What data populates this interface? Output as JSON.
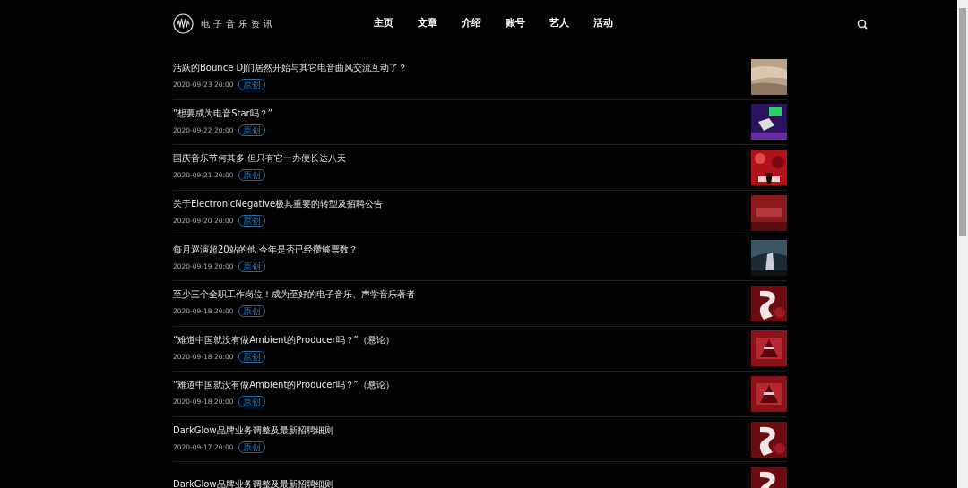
{
  "brand": {
    "name": "电子音乐资讯"
  },
  "nav": [
    {
      "label": "主页"
    },
    {
      "label": "文章"
    },
    {
      "label": "介绍"
    },
    {
      "label": "账号"
    },
    {
      "label": "艺人"
    },
    {
      "label": "活动"
    }
  ],
  "articles": [
    {
      "title": "活跃的Bounce DJ们居然开始与其它电音曲风交流互动了？",
      "date": "2020-09-23 20:00",
      "tag": "原创"
    },
    {
      "title": "“想要成为电音Star吗？”",
      "date": "2020-09-22 20:00",
      "tag": "原创"
    },
    {
      "title": "国庆音乐节何其多 但只有它一办便长达八天",
      "date": "2020-09-21 20:00",
      "tag": "原创"
    },
    {
      "title": "关于ElectronicNegative极其重要的转型及招聘公告",
      "date": "2020-09-20 20:00",
      "tag": "原创"
    },
    {
      "title": "每月巡演超20站的他 今年是否已经攒够票数？",
      "date": "2020-09-19 20:00",
      "tag": "原创"
    },
    {
      "title": "至少三个全职工作岗位！成为至好的电子音乐、声学音乐著者",
      "date": "2020-09-18 20:00",
      "tag": "原创"
    },
    {
      "title": "“难道中国就没有做Ambient的Producer吗？”（悬论）",
      "date": "2020-09-18 20:00",
      "tag": "原创"
    },
    {
      "title": "“难道中国就没有做Ambient的Producer吗？”（悬论）",
      "date": "2020-09-18 20:00",
      "tag": "原创"
    },
    {
      "title": "DarkGlow品牌业务调整及最新招聘细则",
      "date": "2020-09-17 20:00",
      "tag": "原创"
    },
    {
      "title": "DarkGlow品牌业务调整及最新招聘细则"
    }
  ]
}
